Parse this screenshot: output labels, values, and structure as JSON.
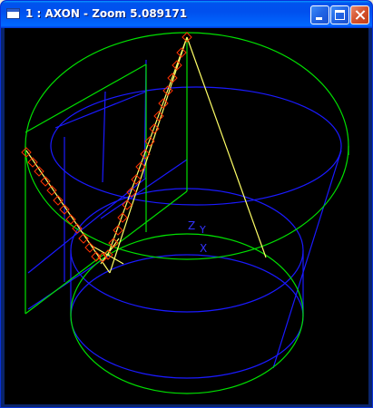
{
  "window": {
    "title": "1 : AXON - Zoom 5.089171"
  },
  "icons": {
    "app": "window-icon",
    "minimize": "minimize-icon",
    "maximize": "maximize-icon",
    "close": "close-icon"
  },
  "scene": {
    "background": "#000000",
    "colors": {
      "green": "#00E000",
      "blue": "#1A1AFF",
      "yellow": "#FFFF66",
      "marker": "#FF3300",
      "axis": "#3333FF"
    },
    "axis_labels": {
      "z": "Z",
      "y": "Y",
      "x": "X"
    }
  }
}
